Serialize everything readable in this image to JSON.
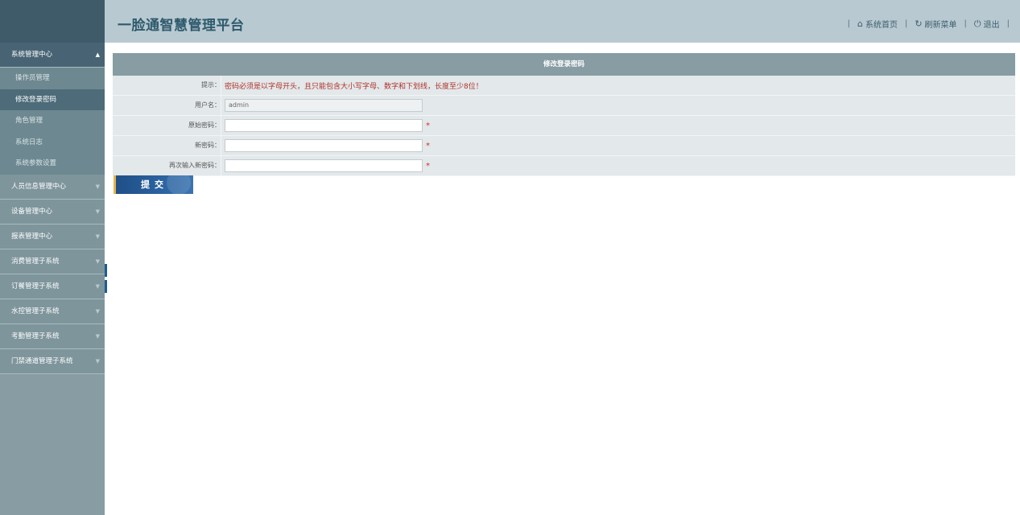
{
  "header": {
    "title": "一脸通智慧管理平台",
    "nav": [
      {
        "icon": "home-icon",
        "label": "系统首页"
      },
      {
        "icon": "refresh-icon",
        "label": "刷新菜单"
      },
      {
        "icon": "power-icon",
        "label": "退出"
      }
    ]
  },
  "sidebar": {
    "groups": [
      {
        "label": "系统管理中心",
        "open": true,
        "items": [
          "操作员管理",
          "修改登录密码",
          "角色管理",
          "系统日志",
          "系统参数设置"
        ],
        "active": "修改登录密码"
      },
      {
        "label": "人员信息管理中心"
      },
      {
        "label": "设备管理中心"
      },
      {
        "label": "报表管理中心"
      },
      {
        "label": "消费管理子系统"
      },
      {
        "label": "订餐管理子系统"
      },
      {
        "label": "水控管理子系统"
      },
      {
        "label": "考勤管理子系统"
      },
      {
        "label": "门禁通道管理子系统"
      }
    ]
  },
  "form": {
    "title": "修改登录密码",
    "hint_label": "提示：",
    "hint_text": "密码必须是以字母开头，且只能包含大小写字母、数字和下划线，长度至少8位！",
    "username_label": "用户名：",
    "username_value": "admin",
    "old_password_label": "原始密码：",
    "new_password_label": "新密码：",
    "confirm_password_label": "再次输入新密码：",
    "required_mark": "*",
    "submit_label": "提交"
  },
  "colors": {
    "header_bg": "#b8c9d1",
    "sidebar_bg": "#879ca3",
    "active_group": "#486474",
    "submit_button": "#2b62a0"
  }
}
